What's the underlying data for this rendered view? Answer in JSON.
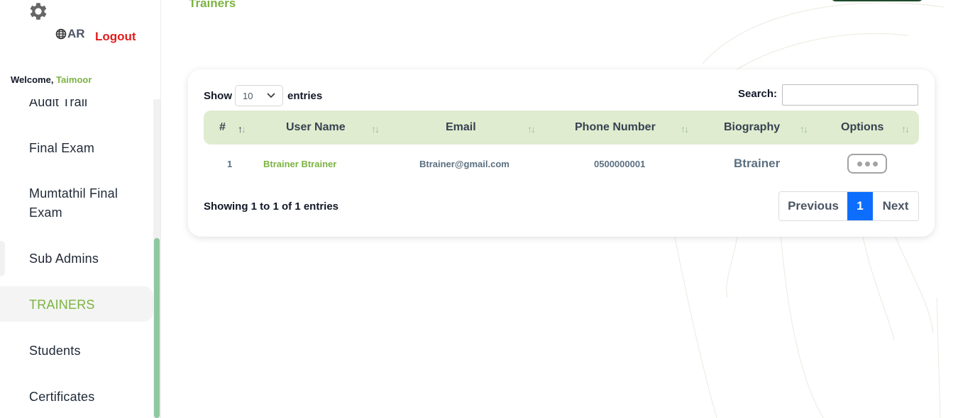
{
  "sidebar": {
    "lang_label": "AR",
    "logout_label": "Logout",
    "welcome_text": "Welcome,",
    "user_name": "Taimoor",
    "items": [
      {
        "label": "Audit Trail"
      },
      {
        "label": "Final Exam"
      },
      {
        "label": "Mumtathil Final Exam"
      },
      {
        "label": "Sub Admins"
      },
      {
        "label": "TRAINERS",
        "active": true
      },
      {
        "label": "Students"
      },
      {
        "label": "Certificates"
      }
    ]
  },
  "page": {
    "title": "Trainers"
  },
  "table_controls": {
    "show_label": "Show",
    "entries_value": "10",
    "entries_label": "entries",
    "search_label": "Search:",
    "search_value": ""
  },
  "table": {
    "columns": [
      "#",
      "User Name",
      "Email",
      "Phone Number",
      "Biography",
      "Options"
    ],
    "rows": [
      {
        "index": "1",
        "user_name": "Btrainer Btrainer",
        "email": "Btrainer@gmail.com",
        "phone": "0500000001",
        "biography": "Btrainer"
      }
    ],
    "info": "Showing 1 to 1 of 1 entries"
  },
  "pagination": {
    "previous": "Previous",
    "current": "1",
    "next": "Next"
  },
  "colors": {
    "accent_green": "#7cb342",
    "header_green": "#dfeccf",
    "logout_red": "#e11d1d",
    "page_blue": "#0d6efd"
  }
}
